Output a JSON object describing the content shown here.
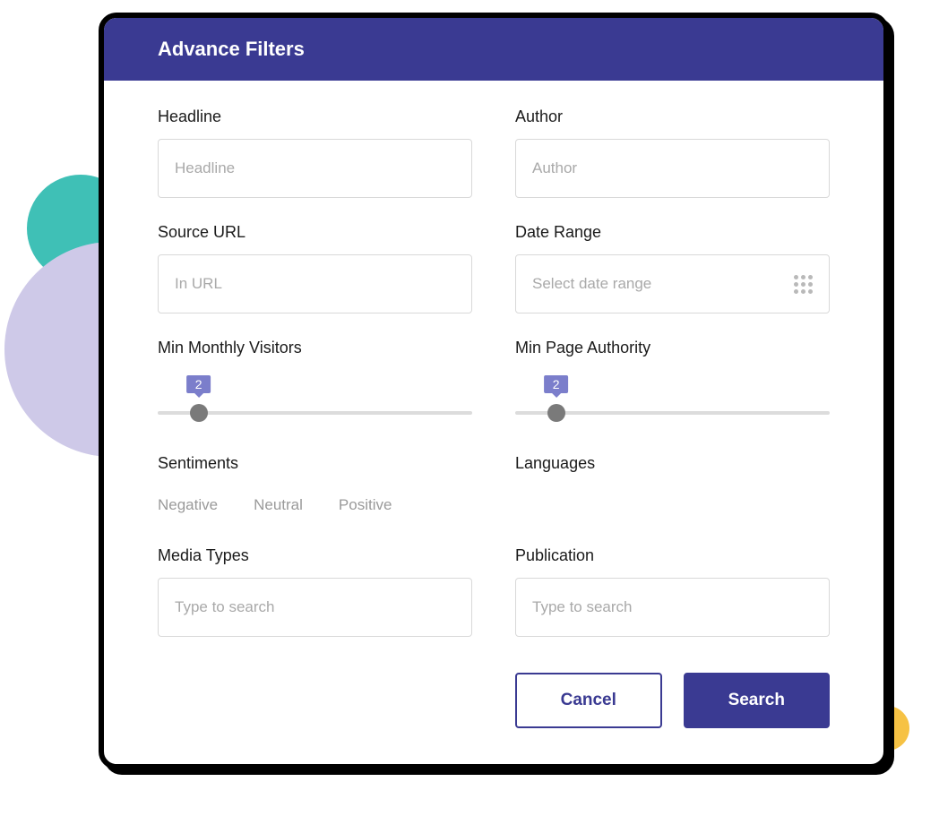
{
  "header": {
    "title": "Advance Filters"
  },
  "fields": {
    "headline": {
      "label": "Headline",
      "placeholder": "Headline"
    },
    "author": {
      "label": "Author",
      "placeholder": "Author"
    },
    "source_url": {
      "label": "Source URL",
      "placeholder": "In URL"
    },
    "date_range": {
      "label": "Date Range",
      "placeholder": "Select date range"
    },
    "min_visitors": {
      "label": "Min Monthly Visitors",
      "value": "2"
    },
    "min_authority": {
      "label": "Min Page Authority",
      "value": "2"
    },
    "sentiments": {
      "label": "Sentiments",
      "options": [
        "Negative",
        "Neutral",
        "Positive"
      ]
    },
    "languages": {
      "label": "Languages"
    },
    "media_types": {
      "label": "Media Types",
      "placeholder": "Type to search"
    },
    "publication": {
      "label": "Publication",
      "placeholder": "Type to search"
    }
  },
  "buttons": {
    "cancel": "Cancel",
    "search": "Search"
  },
  "colors": {
    "brand": "#3a3a92",
    "slider": "#7b7ecb"
  }
}
